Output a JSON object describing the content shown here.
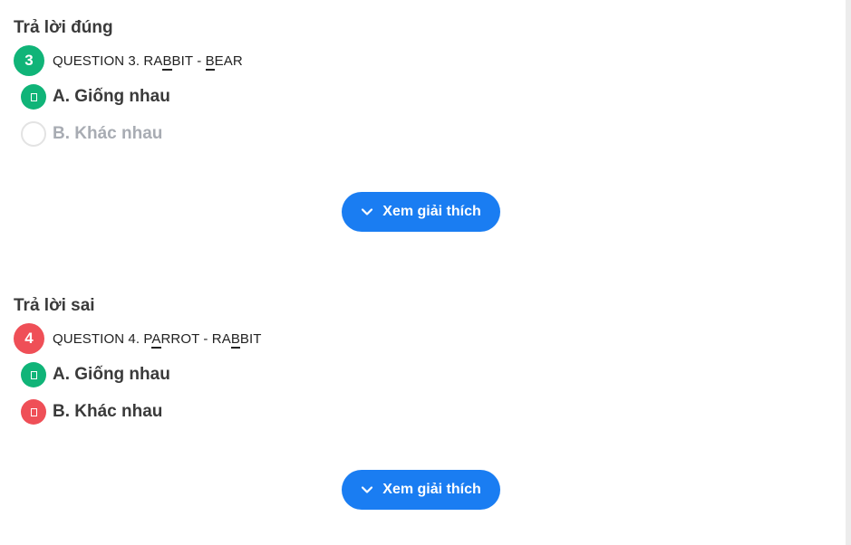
{
  "questions": [
    {
      "status": "Trả lời đúng",
      "number": "3",
      "prefix": "QUESTION 3. ",
      "word1": {
        "before": "RA",
        "underlined": "B",
        "after": "BIT"
      },
      "separator": " - ",
      "word2": {
        "before": "",
        "underlined": "B",
        "after": "EAR"
      },
      "options": [
        {
          "label": "A. Giống nhau",
          "state": "correct"
        },
        {
          "label": "B. Khác nhau",
          "state": "unselected"
        }
      ],
      "explain_label": "Xem giải thích"
    },
    {
      "status": "Trả lời sai",
      "number": "4",
      "prefix": "QUESTION 4. ",
      "word1": {
        "before": "P",
        "underlined": "A",
        "after": "RROT"
      },
      "separator": " - ",
      "word2": {
        "before": "RA",
        "underlined": "B",
        "after": "BIT"
      },
      "options": [
        {
          "label": "A. Giống nhau",
          "state": "correct"
        },
        {
          "label": "B. Khác nhau",
          "state": "wrong"
        }
      ],
      "explain_label": "Xem giải thích"
    }
  ],
  "colors": {
    "correct": "#10b478",
    "wrong": "#ef4f57",
    "button": "#1a7df2"
  },
  "icons": {
    "option_mark": "check-glyph-icon",
    "explain": "chevron-down-icon"
  }
}
